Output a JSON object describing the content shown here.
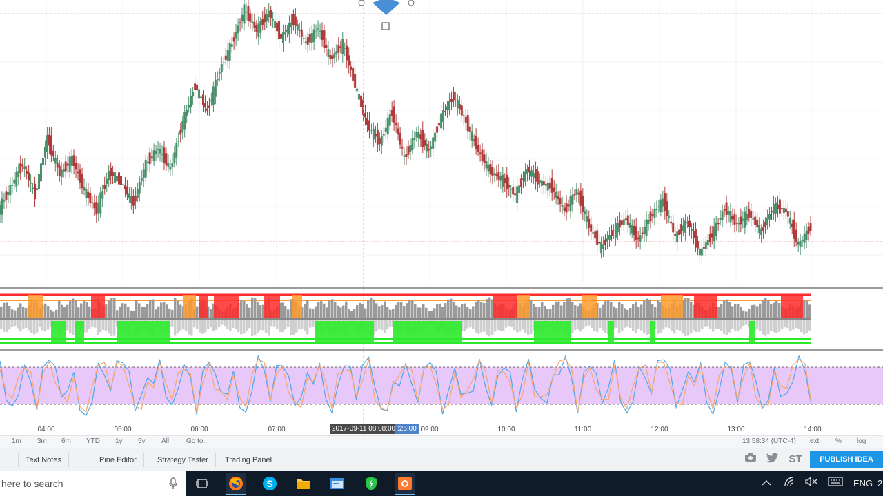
{
  "chart_data": {
    "type": "line",
    "title": "",
    "x_ticks": [
      "04:00",
      "05:00",
      "06:00",
      "07:00",
      "09:00",
      "10:00",
      "11:00",
      "12:00",
      "13:00",
      "14:00"
    ],
    "crosshair_time": "2017-09-11 08:08:00",
    "crosshair_time_partial": ":26:00",
    "price_series": [
      0.22,
      0.31,
      0.4,
      0.28,
      0.5,
      0.36,
      0.42,
      0.3,
      0.22,
      0.37,
      0.33,
      0.25,
      0.4,
      0.46,
      0.38,
      0.56,
      0.7,
      0.6,
      0.76,
      0.86,
      0.99,
      0.91,
      0.98,
      0.88,
      0.95,
      0.86,
      0.92,
      0.8,
      0.86,
      0.7,
      0.55,
      0.48,
      0.6,
      0.42,
      0.52,
      0.45,
      0.58,
      0.66,
      0.56,
      0.45,
      0.37,
      0.34,
      0.28,
      0.38,
      0.33,
      0.31,
      0.22,
      0.3,
      0.16,
      0.08,
      0.15,
      0.19,
      0.11,
      0.2,
      0.26,
      0.12,
      0.18,
      0.06,
      0.13,
      0.23,
      0.17,
      0.21,
      0.14,
      0.24,
      0.22,
      0.09,
      0.16
    ],
    "oscillator_series_1": [
      0.9,
      0.2,
      0.8,
      0.1,
      0.95,
      0.3,
      0.7,
      0.05,
      0.85,
      0.4,
      0.9,
      0.1,
      0.6,
      0.95,
      0.2,
      0.8,
      0.05,
      0.9,
      0.35,
      0.75,
      0.1,
      0.95,
      0.25,
      0.85,
      0.15,
      0.7,
      0.9,
      0.05,
      0.8,
      0.3,
      0.95,
      0.1,
      0.6,
      0.85,
      0.2,
      0.9,
      0.05,
      0.75,
      0.4,
      0.95,
      0.15,
      0.8,
      0.1,
      0.9,
      0.3,
      0.7,
      0.95,
      0.05,
      0.85,
      0.2,
      0.9,
      0.1,
      0.8,
      0.35,
      0.95,
      0.15,
      0.7,
      0.9,
      0.05,
      0.85,
      0.25,
      0.9,
      0.1,
      0.8,
      0.4,
      0.95,
      0.2
    ],
    "oscillator_series_2": [
      0.8,
      0.3,
      0.75,
      0.15,
      0.9,
      0.35,
      0.65,
      0.1,
      0.8,
      0.45,
      0.85,
      0.15,
      0.55,
      0.9,
      0.25,
      0.75,
      0.1,
      0.85,
      0.4,
      0.7,
      0.15,
      0.9,
      0.3,
      0.8,
      0.2,
      0.65,
      0.85,
      0.1,
      0.75,
      0.35,
      0.9,
      0.15,
      0.55,
      0.8,
      0.25,
      0.85,
      0.1,
      0.7,
      0.45,
      0.9,
      0.2,
      0.75,
      0.15,
      0.85,
      0.35,
      0.65,
      0.9,
      0.1,
      0.8,
      0.25,
      0.85,
      0.15,
      0.75,
      0.4,
      0.9,
      0.2,
      0.65,
      0.85,
      0.1,
      0.8,
      0.3,
      0.85,
      0.15,
      0.75,
      0.45,
      0.9,
      0.25
    ],
    "volume_flow": [
      0.4,
      0.6,
      0.3,
      0.7,
      0.5,
      0.8,
      0.35,
      0.65,
      0.45,
      0.75,
      0.55,
      0.3,
      0.6,
      0.8,
      0.4,
      0.7,
      0.5,
      0.65,
      0.35,
      0.75,
      0.45,
      0.6,
      0.3,
      0.7,
      0.55,
      0.8,
      0.4,
      0.65,
      0.5,
      0.75,
      0.35,
      0.6,
      0.45,
      0.7,
      0.55,
      0.8,
      0.4,
      0.65,
      0.3,
      0.75,
      0.5,
      0.6
    ],
    "colors": {
      "up": "#26a69a",
      "down": "#ef5350",
      "candle_up": "#4a8f6c",
      "candle_down": "#b03a3a",
      "orange": "#ff9a2e",
      "red": "#ff2a2a",
      "green": "#2bea2b",
      "osc_band": "#e8c8f8",
      "osc_line1": "#4ea7e8",
      "osc_line2": "#f4a76b"
    }
  },
  "range_bar": {
    "buttons": [
      "1m",
      "3m",
      "6m",
      "YTD",
      "1y",
      "5y",
      "All",
      "Go to..."
    ],
    "clock": "13:58:34 (UTC-4)",
    "ext": "ext",
    "percent": "%",
    "log": "log"
  },
  "bottom_tabs": {
    "tabs": [
      "Text Notes",
      "Pine Editor",
      "Strategy Tester",
      "Trading Panel"
    ],
    "publish_label": "PUBLISH IDEA",
    "st_label": "ST"
  },
  "taskbar": {
    "search_text": "here to search",
    "lang": "ENG",
    "clock_partial": "2"
  }
}
